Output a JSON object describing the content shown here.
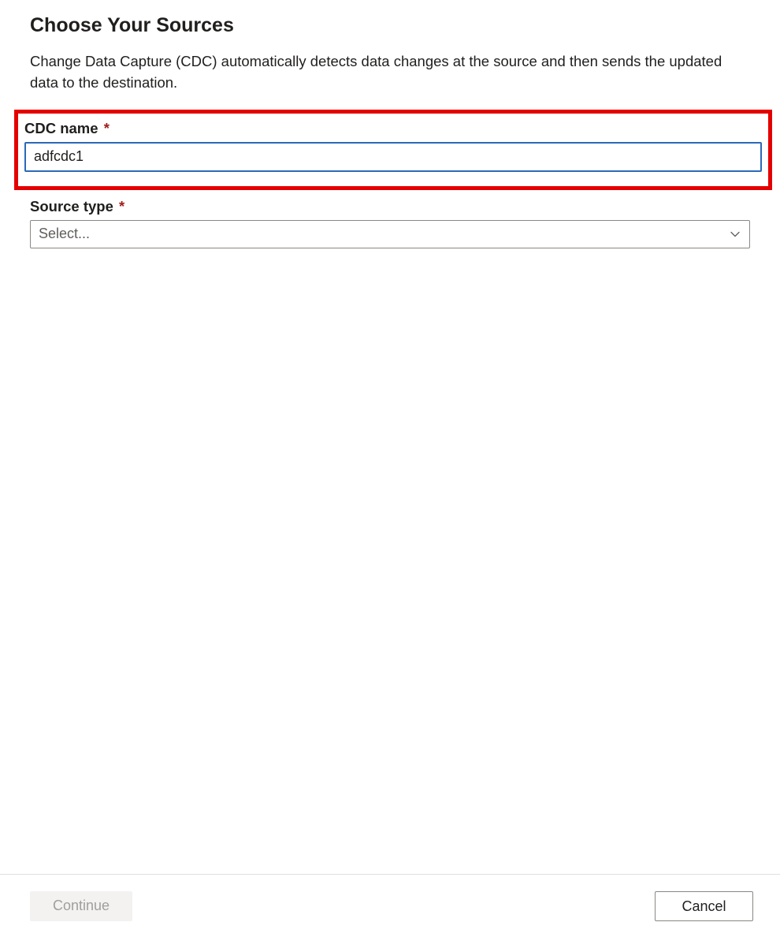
{
  "header": {
    "title": "Choose Your Sources",
    "description": "Change Data Capture (CDC) automatically detects data changes at the source and then sends the updated data to the destination."
  },
  "form": {
    "cdc_name": {
      "label": "CDC name",
      "required_mark": "*",
      "value": "adfcdc1"
    },
    "source_type": {
      "label": "Source type",
      "required_mark": "*",
      "placeholder": "Select..."
    }
  },
  "footer": {
    "continue_label": "Continue",
    "cancel_label": "Cancel"
  }
}
